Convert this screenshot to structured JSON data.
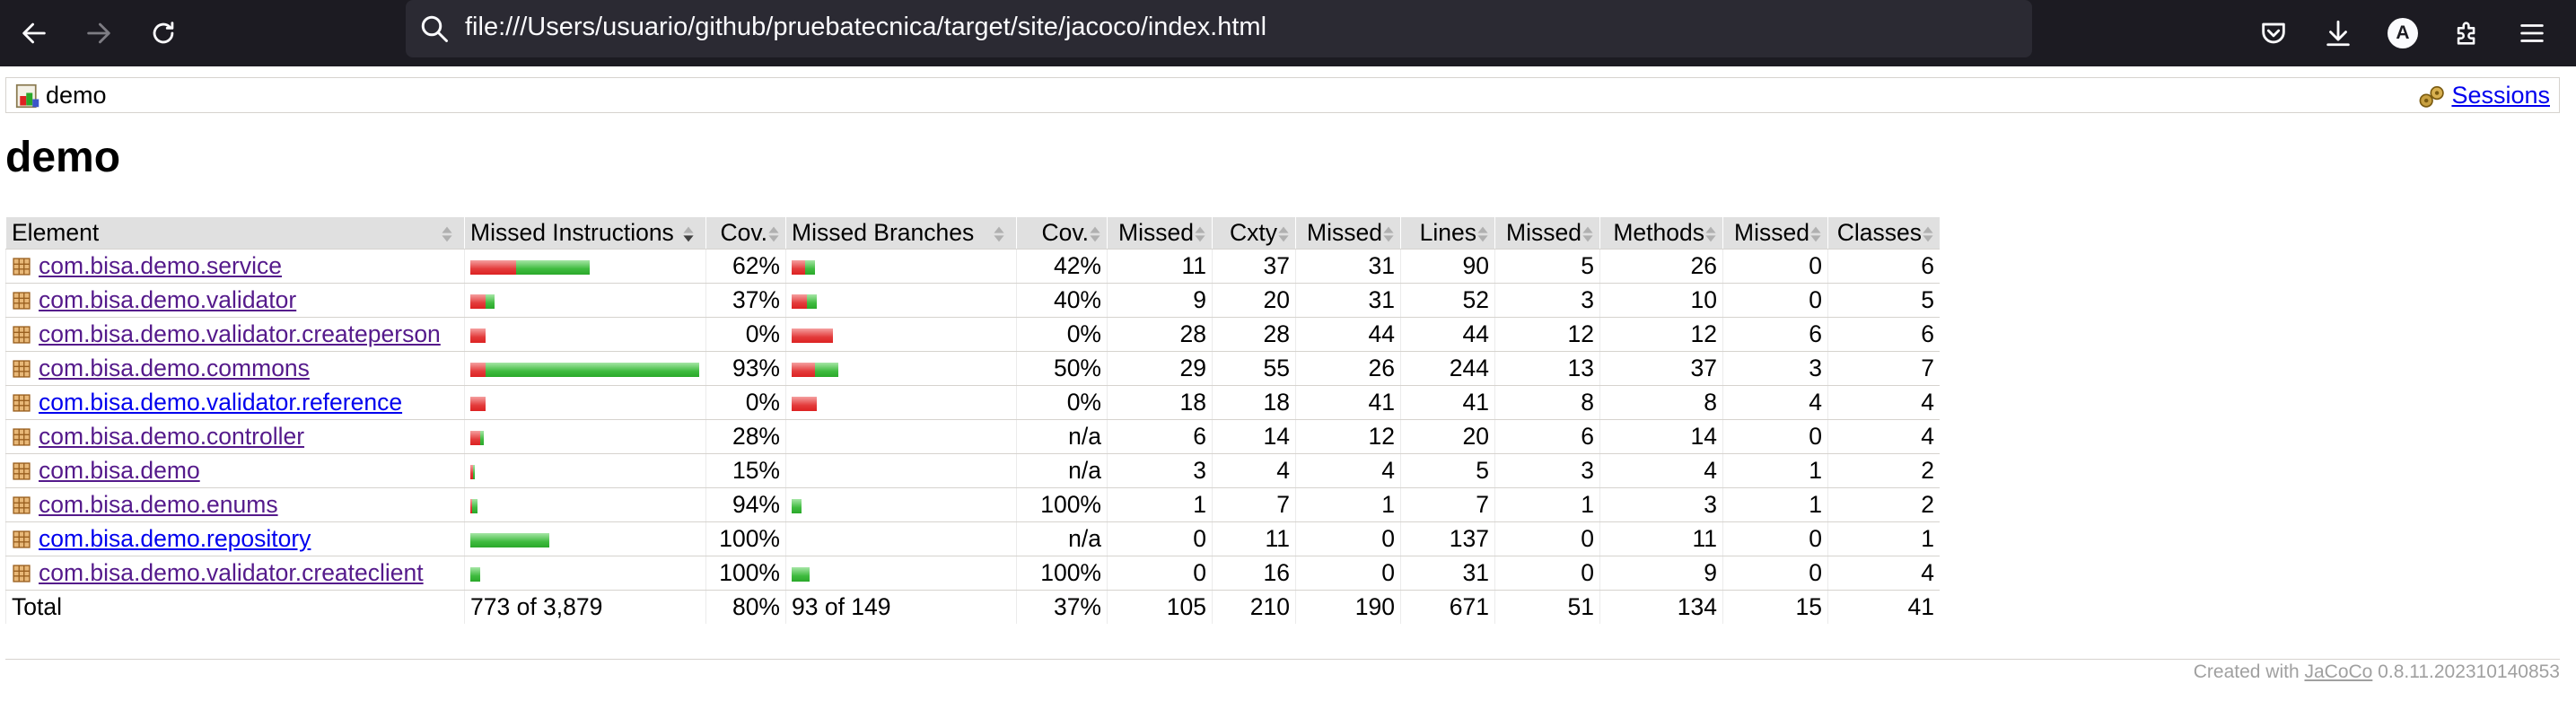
{
  "browser": {
    "url": "file:///Users/usuario/github/pruebatecnica/target/site/jacoco/index.html",
    "profile_initial": "A"
  },
  "breadcrumb": {
    "report": "demo",
    "sessions": "Sessions"
  },
  "title": "demo",
  "table": {
    "headers": {
      "element": "Element",
      "missed_instructions": "Missed Instructions",
      "cov_instructions": "Cov.",
      "missed_branches": "Missed Branches",
      "cov_branches": "Cov.",
      "missed_cxty": "Missed",
      "cxty": "Cxty",
      "missed_lines": "Missed",
      "lines": "Lines",
      "missed_methods": "Missed",
      "methods": "Methods",
      "missed_classes": "Missed",
      "classes": "Classes"
    },
    "rows": [
      {
        "name": "com.bisa.demo.service",
        "visited": true,
        "instr_missed": 60,
        "instr_covered": 97,
        "instr_cov": "62%",
        "branch_missed": 18,
        "branch_covered": 13,
        "branch_cov": "42%",
        "cxty_missed": "11",
        "cxty": "37",
        "lines_missed": "31",
        "lines": "90",
        "methods_missed": "5",
        "methods": "26",
        "classes_missed": "0",
        "classes": "6"
      },
      {
        "name": "com.bisa.demo.validator",
        "visited": true,
        "instr_missed": 20,
        "instr_covered": 12,
        "instr_cov": "37%",
        "branch_missed": 20,
        "branch_covered": 13,
        "branch_cov": "40%",
        "cxty_missed": "9",
        "cxty": "20",
        "lines_missed": "31",
        "lines": "52",
        "methods_missed": "3",
        "methods": "10",
        "classes_missed": "0",
        "classes": "5"
      },
      {
        "name": "com.bisa.demo.validator.createperson",
        "visited": true,
        "instr_missed": 20,
        "instr_covered": 0,
        "instr_cov": "0%",
        "branch_missed": 54,
        "branch_covered": 0,
        "branch_cov": "0%",
        "cxty_missed": "28",
        "cxty": "28",
        "lines_missed": "44",
        "lines": "44",
        "methods_missed": "12",
        "methods": "12",
        "classes_missed": "6",
        "classes": "6"
      },
      {
        "name": "com.bisa.demo.commons",
        "visited": true,
        "instr_missed": 20,
        "instr_covered": 280,
        "instr_cov": "93%",
        "branch_missed": 30,
        "branch_covered": 30,
        "branch_cov": "50%",
        "cxty_missed": "29",
        "cxty": "55",
        "lines_missed": "26",
        "lines": "244",
        "methods_missed": "13",
        "methods": "37",
        "classes_missed": "3",
        "classes": "7"
      },
      {
        "name": "com.bisa.demo.validator.reference",
        "visited": false,
        "instr_missed": 20,
        "instr_covered": 0,
        "instr_cov": "0%",
        "branch_missed": 33,
        "branch_covered": 0,
        "branch_cov": "0%",
        "cxty_missed": "18",
        "cxty": "18",
        "lines_missed": "41",
        "lines": "41",
        "methods_missed": "8",
        "methods": "8",
        "classes_missed": "4",
        "classes": "4"
      },
      {
        "name": "com.bisa.demo.controller",
        "visited": true,
        "instr_missed": 13,
        "instr_covered": 5,
        "instr_cov": "28%",
        "branch_missed": 0,
        "branch_covered": 0,
        "branch_cov": "n/a",
        "cxty_missed": "6",
        "cxty": "14",
        "lines_missed": "12",
        "lines": "20",
        "methods_missed": "6",
        "methods": "14",
        "classes_missed": "0",
        "classes": "4"
      },
      {
        "name": "com.bisa.demo",
        "visited": true,
        "instr_missed": 4,
        "instr_covered": 1,
        "instr_cov": "15%",
        "branch_missed": 0,
        "branch_covered": 0,
        "branch_cov": "n/a",
        "cxty_missed": "3",
        "cxty": "4",
        "lines_missed": "4",
        "lines": "5",
        "methods_missed": "3",
        "methods": "4",
        "classes_missed": "1",
        "classes": "2"
      },
      {
        "name": "com.bisa.demo.enums",
        "visited": true,
        "instr_missed": 1,
        "instr_covered": 7,
        "instr_cov": "94%",
        "branch_missed": 0,
        "branch_covered": 13,
        "branch_cov": "100%",
        "cxty_missed": "1",
        "cxty": "7",
        "lines_missed": "1",
        "lines": "7",
        "methods_missed": "1",
        "methods": "3",
        "classes_missed": "1",
        "classes": "2"
      },
      {
        "name": "com.bisa.demo.repository",
        "visited": false,
        "instr_missed": 0,
        "instr_covered": 103,
        "instr_cov": "100%",
        "branch_missed": 0,
        "branch_covered": 0,
        "branch_cov": "n/a",
        "cxty_missed": "0",
        "cxty": "11",
        "lines_missed": "0",
        "lines": "137",
        "methods_missed": "0",
        "methods": "11",
        "classes_missed": "0",
        "classes": "1"
      },
      {
        "name": "com.bisa.demo.validator.createclient",
        "visited": true,
        "instr_missed": 0,
        "instr_covered": 13,
        "instr_cov": "100%",
        "branch_missed": 0,
        "branch_covered": 23,
        "branch_cov": "100%",
        "cxty_missed": "0",
        "cxty": "16",
        "lines_missed": "0",
        "lines": "31",
        "methods_missed": "0",
        "methods": "9",
        "classes_missed": "0",
        "classes": "4"
      }
    ],
    "total": {
      "label": "Total",
      "instr": "773 of 3,879",
      "instr_cov": "80%",
      "branch": "93 of 149",
      "branch_cov": "37%",
      "cxty_missed": "105",
      "cxty": "210",
      "lines_missed": "190",
      "lines": "671",
      "methods_missed": "51",
      "methods": "134",
      "classes_missed": "15",
      "classes": "41"
    }
  },
  "footer": {
    "prefix": "Created with ",
    "tool": "JaCoCo",
    "version": " 0.8.11.202310140853"
  },
  "colors": {
    "chrome": "#1c1b22",
    "urlbar": "#2b2a33",
    "bar_red": "#e33b3b",
    "bar_green": "#3fbb3f",
    "header": "#e0e0e0"
  }
}
